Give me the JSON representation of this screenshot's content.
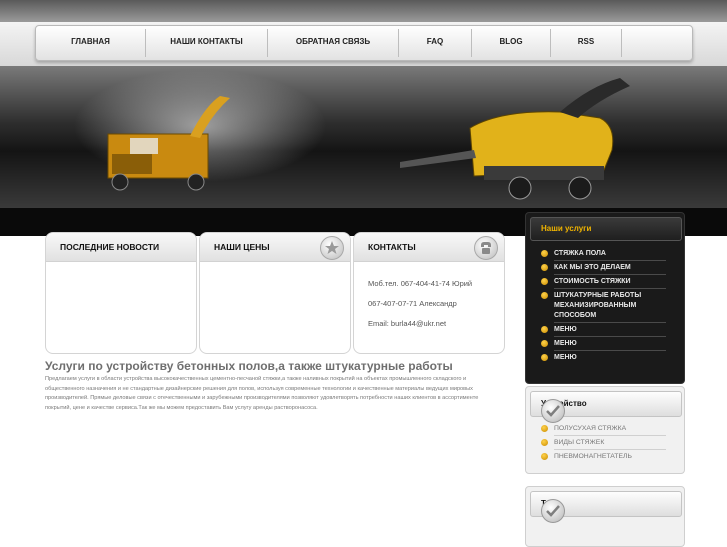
{
  "nav": {
    "items": [
      "ГЛАВНАЯ",
      "НАШИ КОНТАКТЫ",
      "ОБРАТНАЯ СВЯЗЬ",
      "FAQ",
      "BLOG",
      "RSS"
    ]
  },
  "boxes": {
    "news": {
      "title": "ПОСЛЕДНИЕ НОВОСТИ"
    },
    "prices": {
      "title": "НАШИ ЦЕНЫ"
    },
    "contacts": {
      "title": "КОНТАКТЫ",
      "lines": [
        "Моб.тел. 067-404-41-74 Юрий",
        "067-407-07-71 Александр",
        "Email: burla44@ukr.net"
      ]
    }
  },
  "main": {
    "headline": "Услуги по устройству бетонных полов,а также штукатурные работы",
    "body": "Предлагаем услуги в области устройства высококачественных цементно-песчаной стяжки,а также наливных покрытий на объектах промышленного складского и общественного назначения и не стандартные дизайнерские решения для полов, используя современные технологии и качественные материалы ведущих мировых производителей. Прямые деловые связи с отечественными и зарубежными производителями позволяют удовлетворять потребности наших клиентов в ассортименте покрытий, цене и качестве сервиса.Так же мы можем предоставить Вам услугу аренды растворонасоса."
  },
  "sidebar": {
    "services": {
      "title": "Наши услуги",
      "items": [
        "СТЯЖКА ПОЛА",
        "КАК МЫ ЭТО ДЕЛАЕМ",
        "СТОИМОСТЬ СТЯЖКИ",
        "ШТУКАТУРНЫЕ РАБОТЫ МЕХАНИЗИРОВАННЫМ СПОСОБОМ",
        "МЕНЮ",
        "МЕНЮ",
        "МЕНЮ"
      ]
    },
    "device": {
      "title": "Устройство",
      "items": [
        "ПОЛУСУХАЯ СТЯЖКА",
        "ВИДЫ СТЯЖЕК",
        "ПНЕВМОНАГНЕТАТЕЛЬ"
      ]
    },
    "tags": {
      "title": "Тэги"
    }
  },
  "colors": {
    "accent": "#f0b400",
    "dark": "#1a1a1a"
  }
}
